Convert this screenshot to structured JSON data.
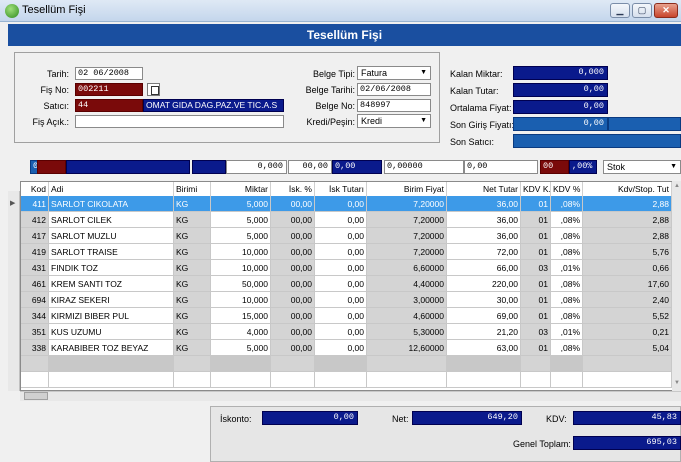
{
  "window": {
    "title": "Tesellüm Fişi",
    "header": "Tesellüm Fişi"
  },
  "form": {
    "tarih_label": "Tarih:",
    "tarih_value": "02 06/2008",
    "fis_no_label": "Fiş No:",
    "fis_no_value": "002211",
    "satici_label": "Satıcı:",
    "satici_code": "44",
    "satici_name": "OMAT GIDA DAG.PAZ.VE TIC.A.S",
    "fis_acik_label": "Fiş Açık.:",
    "fis_acik_value": "",
    "belge_tipi_label": "Belge Tipi:",
    "belge_tipi_value": "Fatura",
    "belge_tarihi_label": "Belge Tarihi:",
    "belge_tarihi_value": "02/06/2008",
    "belge_no_label": "Belge No:",
    "belge_no_value": "848997",
    "kredi_label": "Kredi/Peşin:",
    "kredi_value": "Kredi"
  },
  "summary": {
    "kalan_miktar_label": "Kalan Miktar:",
    "kalan_miktar_value": "0,000",
    "kalan_tutar_label": "Kalan Tutar:",
    "kalan_tutar_value": "0,00",
    "ortalama_fiyat_label": "Ortalama Fiyat:",
    "ortalama_fiyat_value": "0,00",
    "son_giris_fiyati_label": "Son Giriş Fiyatı:",
    "son_giris_fiyati_value": "0,00",
    "son_satici_label": "Son Satıcı:",
    "son_satici_value": ""
  },
  "entry_row": {
    "code": "0",
    "miktar": "0,000",
    "isk_yuzde": "00,00",
    "isk_tutar": "0,00",
    "birim_fiyat": "0,00000",
    "net_tutar": "0,00",
    "kdv_kod": "00",
    "kdv_yuzde": ",00%",
    "kdv_stop": "Stok"
  },
  "columns": [
    "Kod",
    "Adi",
    "Birimi",
    "Miktar",
    "İsk. %",
    "İsk Tutarı",
    "Birim Fiyat",
    "Net Tutar",
    "KDV K.",
    "KDV %",
    "Kdv/Stop. Tut"
  ],
  "rows": [
    {
      "kod": "411",
      "adi": "SARLOT CIKOLATA",
      "birimi": "KG",
      "miktar": "5,000",
      "isk": "00,00",
      "isk_tutar": "0,00",
      "birim_fiyat": "7,20000",
      "net": "36,00",
      "kdv_k": "01",
      "kdv_p": ",08%",
      "kdv_tut": "2,88"
    },
    {
      "kod": "412",
      "adi": "SARLOT CILEK",
      "birimi": "KG",
      "miktar": "5,000",
      "isk": "00,00",
      "isk_tutar": "0,00",
      "birim_fiyat": "7,20000",
      "net": "36,00",
      "kdv_k": "01",
      "kdv_p": ",08%",
      "kdv_tut": "2,88"
    },
    {
      "kod": "417",
      "adi": "SARLOT MUZLU",
      "birimi": "KG",
      "miktar": "5,000",
      "isk": "00,00",
      "isk_tutar": "0,00",
      "birim_fiyat": "7,20000",
      "net": "36,00",
      "kdv_k": "01",
      "kdv_p": ",08%",
      "kdv_tut": "2,88"
    },
    {
      "kod": "419",
      "adi": "SARLOT TRAISE",
      "birimi": "KG",
      "miktar": "10,000",
      "isk": "00,00",
      "isk_tutar": "0,00",
      "birim_fiyat": "7,20000",
      "net": "72,00",
      "kdv_k": "01",
      "kdv_p": ",08%",
      "kdv_tut": "5,76"
    },
    {
      "kod": "431",
      "adi": "FINDIK TOZ",
      "birimi": "KG",
      "miktar": "10,000",
      "isk": "00,00",
      "isk_tutar": "0,00",
      "birim_fiyat": "6,60000",
      "net": "66,00",
      "kdv_k": "03",
      "kdv_p": ",01%",
      "kdv_tut": "0,66"
    },
    {
      "kod": "461",
      "adi": "KREM SANTI TOZ",
      "birimi": "KG",
      "miktar": "50,000",
      "isk": "00,00",
      "isk_tutar": "0,00",
      "birim_fiyat": "4,40000",
      "net": "220,00",
      "kdv_k": "01",
      "kdv_p": ",08%",
      "kdv_tut": "17,60"
    },
    {
      "kod": "694",
      "adi": "KIRAZ SEKERI",
      "birimi": "KG",
      "miktar": "10,000",
      "isk": "00,00",
      "isk_tutar": "0,00",
      "birim_fiyat": "3,00000",
      "net": "30,00",
      "kdv_k": "01",
      "kdv_p": ",08%",
      "kdv_tut": "2,40"
    },
    {
      "kod": "344",
      "adi": "KIRMIZI BIBER PUL",
      "birimi": "KG",
      "miktar": "15,000",
      "isk": "00,00",
      "isk_tutar": "0,00",
      "birim_fiyat": "4,60000",
      "net": "69,00",
      "kdv_k": "01",
      "kdv_p": ",08%",
      "kdv_tut": "5,52"
    },
    {
      "kod": "351",
      "adi": "KUS UZUMU",
      "birimi": "KG",
      "miktar": "4,000",
      "isk": "00,00",
      "isk_tutar": "0,00",
      "birim_fiyat": "5,30000",
      "net": "21,20",
      "kdv_k": "03",
      "kdv_p": ",01%",
      "kdv_tut": "0,21"
    },
    {
      "kod": "338",
      "adi": "KARABIBER TOZ BEYAZ",
      "birimi": "KG",
      "miktar": "5,000",
      "isk": "00,00",
      "isk_tutar": "0,00",
      "birim_fiyat": "12,60000",
      "net": "63,00",
      "kdv_k": "01",
      "kdv_p": ",08%",
      "kdv_tut": "5,04"
    }
  ],
  "totals": {
    "iskonto_label": "İskonto:",
    "iskonto_value": "0,00",
    "net_label": "Net:",
    "net_value": "649,20",
    "kdv_label": "KDV:",
    "kdv_value": "45,83",
    "genel_toplam_label": "Genel Toplam:",
    "genel_toplam_value": "695,03"
  },
  "colors": {
    "navy": "#0a1a8c",
    "header_blue": "#1a4fa0",
    "selection": "#3d9ae8",
    "dark_red": "#7a0a0a"
  }
}
